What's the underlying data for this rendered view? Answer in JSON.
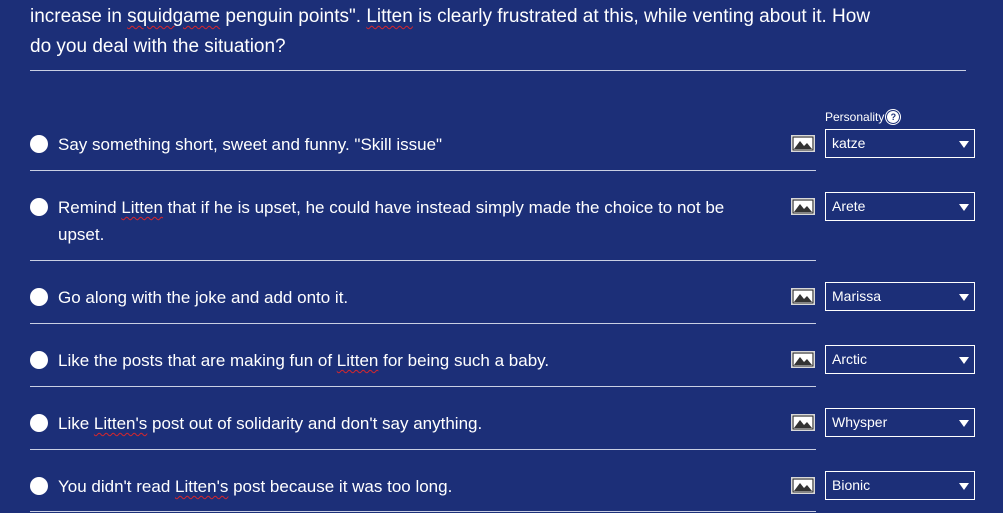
{
  "question": {
    "line1_parts": [
      "increase in ",
      "squidgame",
      " penguin points\". ",
      "Litten",
      " is clearly frustrated at this, while venting about it. How"
    ],
    "line2": "do you deal with the situation?"
  },
  "personality": {
    "label": "Personality",
    "help_icon": "question-circle-icon"
  },
  "options": [
    {
      "text_parts": [
        "Say something short, sweet and funny. \"Skill issue\""
      ],
      "personality": "katze",
      "image_icon": "image-icon"
    },
    {
      "text_parts": [
        "Remind ",
        "Litten",
        " that if he is upset, he could have instead simply made the choice to not be upset."
      ],
      "personality": "Arete",
      "image_icon": "image-icon"
    },
    {
      "text_parts": [
        "Go along with the joke and add onto it."
      ],
      "personality": "Marissa",
      "image_icon": "image-icon"
    },
    {
      "text_parts": [
        "Like the posts that are making fun of ",
        "Litten",
        " for being such a baby."
      ],
      "personality": "Arctic",
      "image_icon": "image-icon"
    },
    {
      "text_parts": [
        "Like ",
        "Litten's",
        " post out of solidarity and don't say anything."
      ],
      "personality": "Whysper",
      "image_icon": "image-icon"
    },
    {
      "text_parts": [
        "You didn't read ",
        "Litten's",
        " post because it was too long."
      ],
      "personality": "Bionic",
      "image_icon": "image-icon"
    }
  ]
}
